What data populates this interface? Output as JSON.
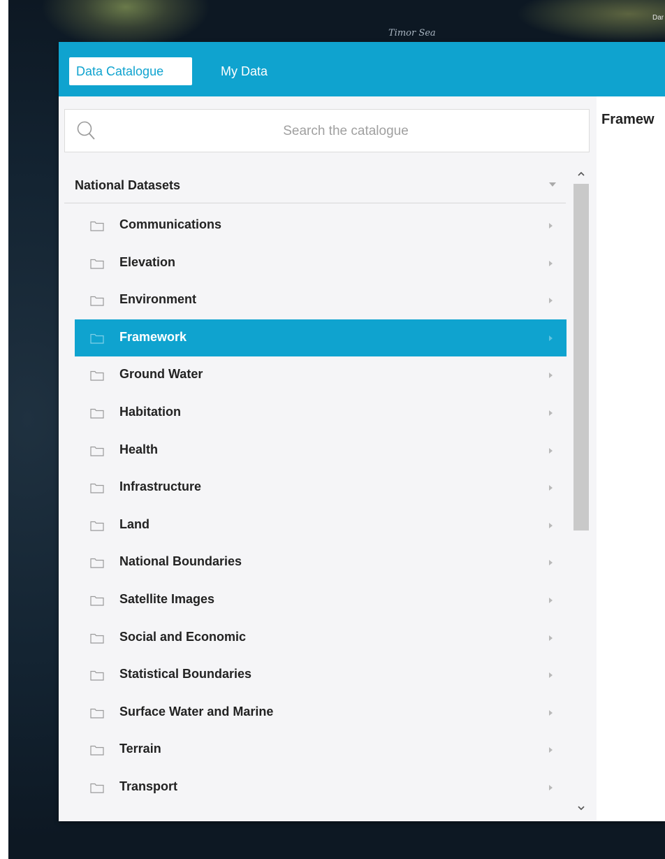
{
  "map": {
    "labels": [
      "Timor Sea",
      "Dar"
    ]
  },
  "tabs": [
    {
      "label": "Data Catalogue",
      "active": true
    },
    {
      "label": "My Data",
      "active": false
    }
  ],
  "search": {
    "placeholder": "Search the catalogue",
    "value": ""
  },
  "group": {
    "title": "National Datasets"
  },
  "items": [
    {
      "label": "Communications",
      "selected": false
    },
    {
      "label": "Elevation",
      "selected": false
    },
    {
      "label": "Environment",
      "selected": false
    },
    {
      "label": "Framework",
      "selected": true
    },
    {
      "label": "Ground Water",
      "selected": false
    },
    {
      "label": "Habitation",
      "selected": false
    },
    {
      "label": "Health",
      "selected": false
    },
    {
      "label": "Infrastructure",
      "selected": false
    },
    {
      "label": "Land",
      "selected": false
    },
    {
      "label": "National Boundaries",
      "selected": false
    },
    {
      "label": "Satellite Images",
      "selected": false
    },
    {
      "label": "Social and Economic",
      "selected": false
    },
    {
      "label": "Statistical Boundaries",
      "selected": false
    },
    {
      "label": "Surface Water and Marine",
      "selected": false
    },
    {
      "label": "Terrain",
      "selected": false
    },
    {
      "label": "Transport",
      "selected": false
    }
  ],
  "detail": {
    "title": "Framew"
  },
  "colors": {
    "accent": "#0fa3cf",
    "panel_bg": "#f5f5f7"
  }
}
